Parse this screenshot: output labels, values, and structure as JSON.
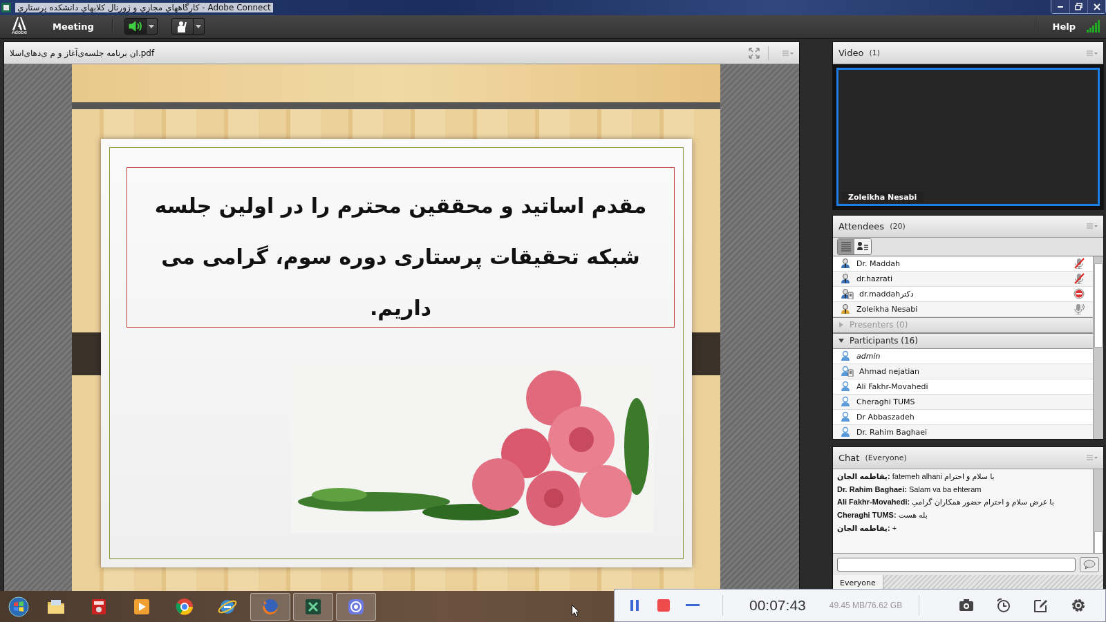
{
  "window": {
    "title": "کارگاههاي مجازي و ژورنال کلابهاي دانشکده پرستاري - Adobe Connect"
  },
  "toolbar": {
    "logo_text": "Adobe",
    "menu": "Meeting",
    "speaker_on": true,
    "help": "Help"
  },
  "share_pod": {
    "filename": "ان برنامه جلسه‌ی‌آغاز و م ی‌دهای‌اسلا.pdf"
  },
  "slide": {
    "text": "مقدم اساتید و محققین محترم را در اولین جلسه شبکه تحقیقات پرستاری دوره سوم، گرامی می داریم."
  },
  "video_pod": {
    "title": "Video",
    "count": "(1)",
    "feed_label": "Zoleikha Nesabi"
  },
  "attendees": {
    "title": "Attendees",
    "count": "(20)",
    "view_modes": [
      {
        "kind": "list",
        "selected": true
      },
      {
        "kind": "details",
        "selected": false
      }
    ],
    "hosts": [
      {
        "name": "Dr. Maddah",
        "kind": "host",
        "phone": false,
        "status_icon": {
          "kind": "mic-off"
        }
      },
      {
        "name": "dr.hazrati",
        "kind": "host",
        "phone": false,
        "status_icon": {
          "kind": "mic-off"
        }
      },
      {
        "name": "dr.maddahدکتر",
        "kind": "host",
        "phone": true,
        "status_icon": {
          "kind": "blocked"
        }
      },
      {
        "name": "Zoleikha Nesabi",
        "kind": "presenter",
        "phone": false,
        "status_icon": {
          "kind": "mic-on"
        }
      }
    ],
    "sections": [
      {
        "label": "Presenters (0)",
        "expanded": false
      },
      {
        "label": "Participants (16)",
        "expanded": true,
        "items": [
          {
            "name": "admin",
            "phone": false,
            "is_you": true
          },
          {
            "name": "Ahmad nejatian",
            "phone": true,
            "is_you": false
          },
          {
            "name": "Ali Fakhr-Movahedi",
            "phone": false,
            "is_you": false
          },
          {
            "name": "Cheraghi TUMS",
            "phone": false,
            "is_you": false
          },
          {
            "name": "Dr Abbaszadeh",
            "phone": false,
            "is_you": false
          },
          {
            "name": "Dr. Rahim Baghaei",
            "phone": false,
            "is_you": false
          }
        ]
      }
    ]
  },
  "chat": {
    "title": "Chat",
    "scope": "(Everyone)",
    "messages": [
      {
        "text": "**یفاطمه الجان:** fatemeh alhani  با سلام و احترام"
      },
      {
        "text": "**Dr. Rahim Baghaei:** Salam va ba ehteram"
      },
      {
        "text": "**Ali Fakhr-Movahedi:** با عرض سلام و احترام حضور همکاران گرامي"
      },
      {
        "text": "**Cheraghi TUMS:** بله هست"
      },
      {
        "text": "**یفاطمه الجان:** +"
      }
    ],
    "tabs": [
      {
        "label": "Everyone",
        "selected": true
      }
    ]
  },
  "taskbar": {
    "apps": [
      {
        "kind": "folder",
        "active": false
      },
      {
        "kind": "dictionary",
        "active": false
      },
      {
        "kind": "media",
        "active": false
      },
      {
        "kind": "browser-ring",
        "active": false
      },
      {
        "kind": "browser-e",
        "active": false
      },
      {
        "kind": "fox",
        "active": true
      },
      {
        "kind": "green-app",
        "active": true
      },
      {
        "kind": "recorder",
        "active": true
      }
    ]
  },
  "recorder": {
    "time": "00:07:43",
    "storage": "49.45 MB/76.62 GB"
  }
}
